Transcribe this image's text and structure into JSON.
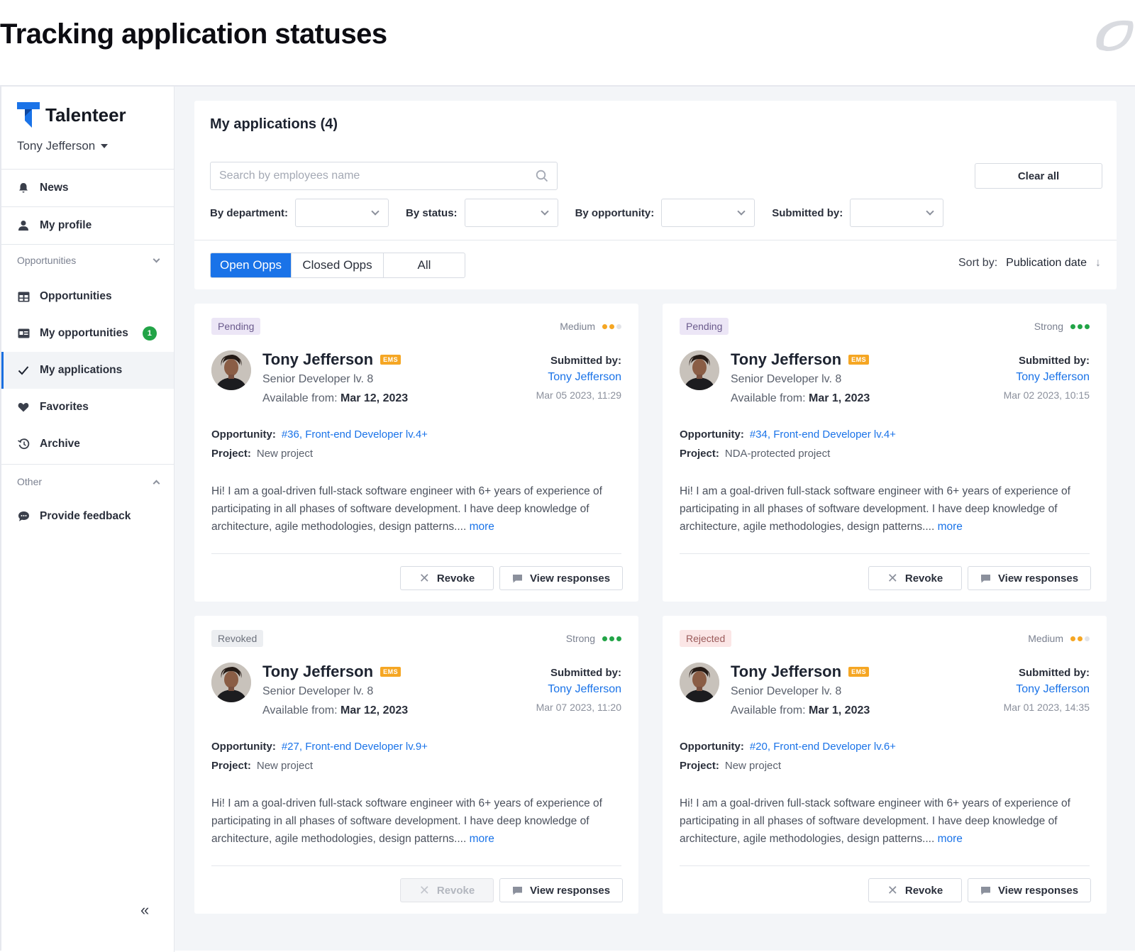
{
  "page": {
    "heading": "Tracking application statuses"
  },
  "sidebar": {
    "brand": "Talenteer",
    "user": "Tony Jefferson",
    "items": [
      {
        "label": "News",
        "icon": "bell-icon"
      },
      {
        "label": "My profile",
        "icon": "user-icon"
      },
      {
        "label": "Opportunities",
        "icon": "table-icon"
      },
      {
        "label": "My opportunities",
        "icon": "id-card-icon",
        "badge": "1"
      },
      {
        "label": "My applications",
        "icon": "check-icon",
        "active": true
      },
      {
        "label": "Favorites",
        "icon": "heart-icon"
      },
      {
        "label": "Archive",
        "icon": "history-icon"
      },
      {
        "label": "Provide feedback",
        "icon": "chat-icon"
      }
    ],
    "groups": {
      "opportunities": "Opportunities",
      "other": "Other"
    },
    "collapse_label": "«"
  },
  "filters": {
    "title": "My applications (4)",
    "search_placeholder": "Search by employees name",
    "clear_all": "Clear all",
    "by_department": "By department:",
    "by_status": "By status:",
    "by_opportunity": "By opportunity:",
    "submitted_by": "Submitted by:",
    "tabs": [
      "Open Opps",
      "Closed Opps",
      "All"
    ],
    "active_tab": "Open Opps",
    "sort_label": "Sort by:",
    "sort_value": "Publication date"
  },
  "colors": {
    "accent": "#1a73e8",
    "strong": "#22a447",
    "medium": "#f5a623",
    "dot_empty": "#e2e4e8"
  },
  "common": {
    "submitted_label": "Submitted by:",
    "opp_label": "Opportunity:",
    "proj_label": "Project:",
    "avail_label": "Available from:",
    "bio": "Hi! I am a goal-driven full-stack software engineer with 6+ years of experience of participating in all phases of software development. I have deep knowledge of architecture, agile methodologies, design patterns....",
    "more": "more",
    "revoke": "Revoke",
    "view_responses": "View responses",
    "ems": "EMS"
  },
  "applications": [
    {
      "status": "Pending",
      "match": "Medium",
      "match_level": 2,
      "name": "Tony Jefferson",
      "role": "Senior Developer lv. 8",
      "available": "Mar 12, 2023",
      "submitted_by": "Tony Jefferson",
      "submitted_at": "Mar 05 2023, 11:29",
      "opportunity": "#36, Front-end Developer lv.4+",
      "project": "New project",
      "revoke_enabled": true
    },
    {
      "status": "Pending",
      "match": "Strong",
      "match_level": 3,
      "name": "Tony Jefferson",
      "role": "Senior Developer lv. 8",
      "available": "Mar 1, 2023",
      "submitted_by": "Tony Jefferson",
      "submitted_at": "Mar 02 2023, 10:15",
      "opportunity": "#34, Front-end Developer lv.4+",
      "project": "NDA-protected project",
      "revoke_enabled": true
    },
    {
      "status": "Revoked",
      "match": "Strong",
      "match_level": 3,
      "name": "Tony Jefferson",
      "role": "Senior Developer lv. 8",
      "available": "Mar 12, 2023",
      "submitted_by": "Tony Jefferson",
      "submitted_at": "Mar 07 2023, 11:20",
      "opportunity": "#27, Front-end Developer lv.9+",
      "project": "New project",
      "revoke_enabled": false
    },
    {
      "status": "Rejected",
      "match": "Medium",
      "match_level": 2,
      "name": "Tony Jefferson",
      "role": "Senior Developer lv. 8",
      "available": "Mar 1, 2023",
      "submitted_by": "Tony Jefferson",
      "submitted_at": "Mar 01 2023, 14:35",
      "opportunity": "#20, Front-end Developer lv.6+",
      "project": "New project",
      "revoke_enabled": true
    }
  ]
}
